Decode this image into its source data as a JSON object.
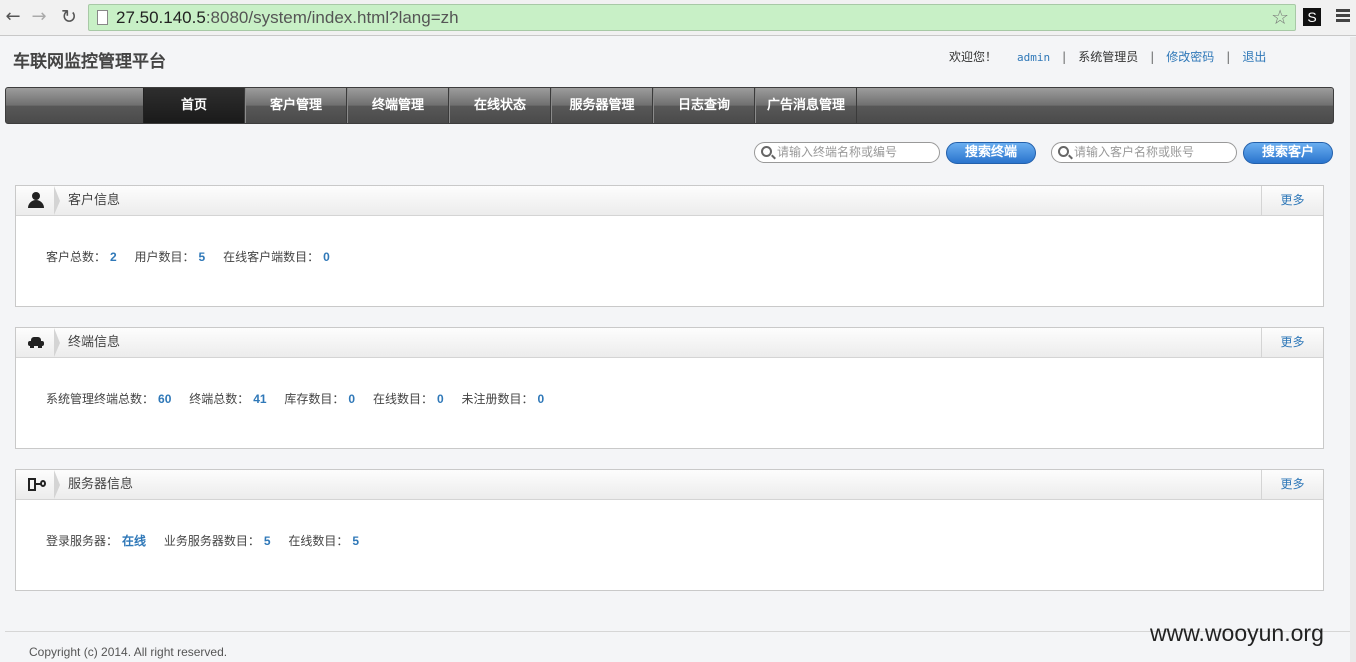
{
  "browser": {
    "url_host": "27.50.140.5",
    "url_rest": ":8080/system/index.html?lang=zh",
    "ext_label": "S"
  },
  "header": {
    "title": "车联网监控管理平台",
    "welcome": "欢迎您！",
    "user": "admin",
    "role": "系统管理员",
    "change_password": "修改密码",
    "logout": "退出"
  },
  "nav": {
    "tabs": [
      "首页",
      "客户管理",
      "终端管理",
      "在线状态",
      "服务器管理",
      "日志查询",
      "广告消息管理"
    ]
  },
  "search": {
    "terminal_placeholder": "请输入终端名称或编号",
    "terminal_button": "搜索终端",
    "customer_placeholder": "请输入客户名称或账号",
    "customer_button": "搜索客户"
  },
  "panels": {
    "customer": {
      "title": "客户信息",
      "more": "更多",
      "stats": [
        {
          "label": "客户总数：",
          "value": "2"
        },
        {
          "label": "用户数目：",
          "value": "5"
        },
        {
          "label": "在线客户端数目：",
          "value": "0"
        }
      ]
    },
    "terminal": {
      "title": "终端信息",
      "more": "更多",
      "stats": [
        {
          "label": "系统管理终端总数：",
          "value": "60"
        },
        {
          "label": "终端总数：",
          "value": "41"
        },
        {
          "label": "库存数目：",
          "value": "0"
        },
        {
          "label": "在线数目：",
          "value": "0"
        },
        {
          "label": "未注册数目：",
          "value": "0"
        }
      ]
    },
    "server": {
      "title": "服务器信息",
      "more": "更多",
      "stats": [
        {
          "label": "登录服务器：",
          "value": "在线"
        },
        {
          "label": "业务服务器数目：",
          "value": "5"
        },
        {
          "label": "在线数目：",
          "value": "5"
        }
      ]
    }
  },
  "footer": {
    "copyright": "Copyright (c) 2014. All right reserved.",
    "watermark": "www.wooyun.org"
  }
}
